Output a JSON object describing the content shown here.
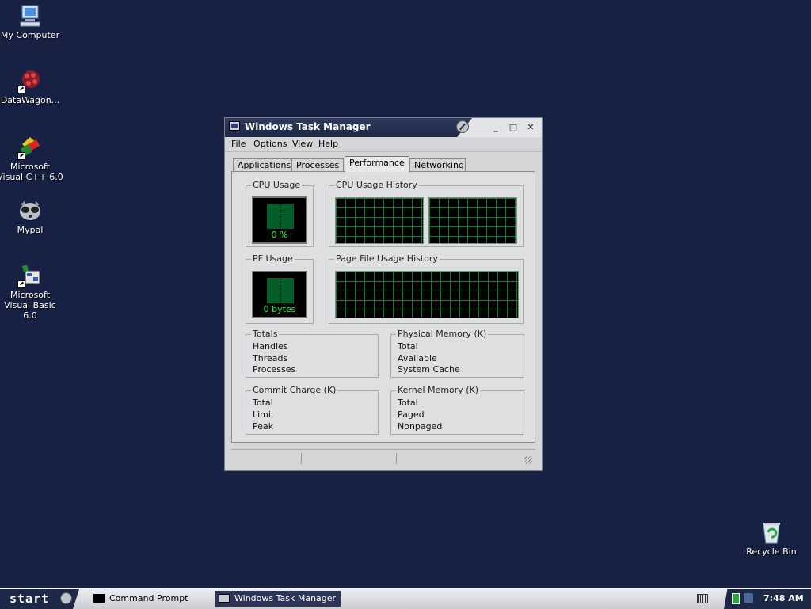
{
  "desktop": {
    "icons": [
      {
        "label": "My Computer"
      },
      {
        "label": "DataWagon..."
      },
      {
        "label": "Microsoft Visual C++ 6.0"
      },
      {
        "label": "Mypal"
      },
      {
        "label": "Microsoft Visual Basic 6.0"
      },
      {
        "label": "Recycle Bin"
      }
    ]
  },
  "window": {
    "title": "Windows Task Manager",
    "menu": [
      "File",
      "Options",
      "View",
      "Help"
    ],
    "tabs": [
      "Applications",
      "Processes",
      "Performance",
      "Networking"
    ],
    "active_tab": "Performance",
    "cpu_usage": {
      "label": "CPU Usage",
      "value": "0 %"
    },
    "cpu_history": {
      "label": "CPU Usage History"
    },
    "pf_usage": {
      "label": "PF Usage",
      "value": "0 bytes"
    },
    "pf_history": {
      "label": "Page File Usage History"
    },
    "totals": {
      "label": "Totals",
      "rows": [
        "Handles",
        "Threads",
        "Processes"
      ]
    },
    "physical_memory": {
      "label": "Physical Memory (K)",
      "rows": [
        "Total",
        "Available",
        "System Cache"
      ]
    },
    "commit_charge": {
      "label": "Commit Charge (K)",
      "rows": [
        "Total",
        "Limit",
        "Peak"
      ]
    },
    "kernel_memory": {
      "label": "Kernel Memory (K)",
      "rows": [
        "Total",
        "Paged",
        "Nonpaged"
      ]
    }
  },
  "taskbar": {
    "start_label": "start",
    "tasks": [
      {
        "label": "Command Prompt",
        "active": false
      },
      {
        "label": "Windows Task Manager",
        "active": true
      }
    ],
    "clock": "7:48 AM"
  },
  "colors": {
    "desktop": "#172143",
    "graph_grid": "#0a7d2a",
    "graph_text": "#2ef03a"
  }
}
